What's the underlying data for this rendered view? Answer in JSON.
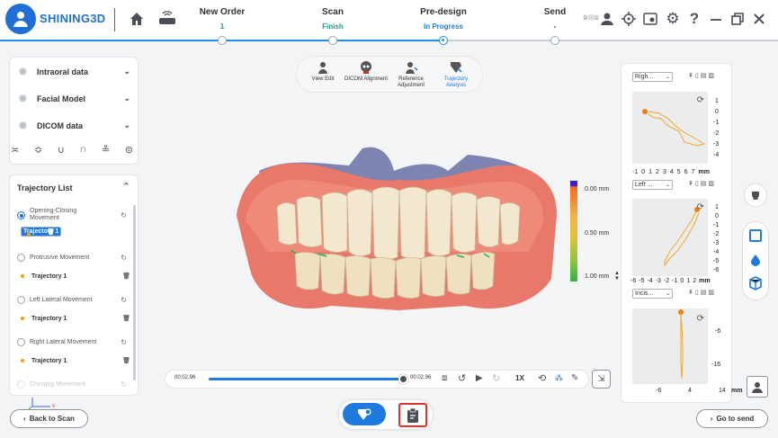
{
  "header": {
    "brand": "SHINING3D",
    "user_name": "曾翊宸",
    "steps": [
      {
        "label": "New Order",
        "status": "1"
      },
      {
        "label": "Scan",
        "status": "Finish"
      },
      {
        "label": "Pre-design",
        "status": "In Progress"
      },
      {
        "label": "Send",
        "status": "-"
      }
    ]
  },
  "data_panel": {
    "items": [
      {
        "label": "Intraoral data"
      },
      {
        "label": "Facial Model"
      },
      {
        "label": "DICOM data"
      }
    ]
  },
  "toolbar": {
    "tools": [
      "View Edit",
      "DICOM Alignment",
      "Reference Adjustment",
      "Trajectory Analysis"
    ]
  },
  "trajectory_list": {
    "title": "Trajectory List",
    "groups": [
      {
        "label": "Opening-Closing Movement",
        "traj": "Trajectory 1"
      },
      {
        "label": "Protrusive Movement",
        "traj": "Trajectory 1"
      },
      {
        "label": "Left Lateral Movement",
        "traj": "Trajectory 1"
      },
      {
        "label": "Right Lateral Movement",
        "traj": "Trajectory 1"
      },
      {
        "label": "Chewing Movement"
      }
    ]
  },
  "legend": {
    "top": "0.00 mm",
    "mid": "0.50 mm",
    "bottom": "1.00 mm"
  },
  "player": {
    "time_current": "00:02.96",
    "time_total": "00:02.96",
    "speed": "1X",
    "progress": 1.0
  },
  "charts": {
    "c1": {
      "view": "Righ...",
      "xticks": [
        "-1",
        "0",
        "1",
        "2",
        "3",
        "4",
        "5",
        "6",
        "7"
      ],
      "yticks": [
        "1",
        "0",
        "-1",
        "-2",
        "-3",
        "-4"
      ],
      "unit": "mm"
    },
    "c2": {
      "view": "Left ...",
      "xticks": [
        "-6",
        "-5",
        "-4",
        "-3",
        "-2",
        "-1",
        "0",
        "1",
        "2"
      ],
      "yticks": [
        "1",
        "0",
        "-1",
        "-2",
        "-3",
        "-4",
        "-5",
        "-6"
      ],
      "unit": "mm"
    },
    "c3": {
      "view": "Incis...",
      "xticks": [
        "-6",
        "4",
        "14"
      ],
      "yticks": [
        "-6",
        "-16"
      ],
      "unit": "mm"
    }
  },
  "colors": {
    "accent": "#1f7ae0",
    "trajectory": "#f39c12",
    "scan_finish": "#16a085"
  },
  "footer": {
    "back": "Back to Scan",
    "next": "Go to send"
  }
}
